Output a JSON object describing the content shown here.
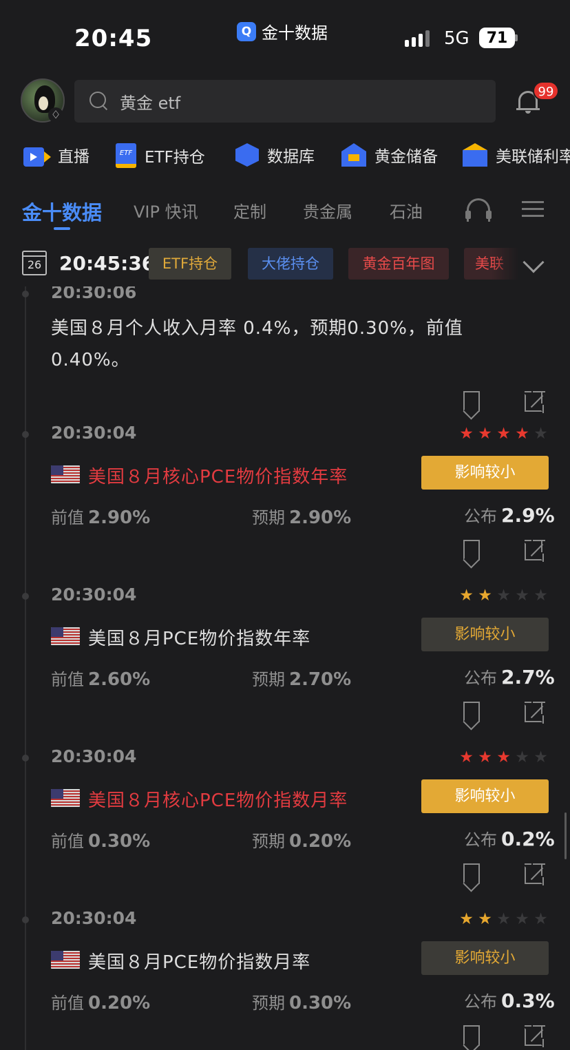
{
  "status_bar": {
    "time": "20:45",
    "app_name": "金十数据",
    "network": "5G",
    "battery": "71"
  },
  "search": {
    "value": "黄金 etf",
    "notification_count": "99"
  },
  "quick_nav": [
    {
      "label": "直播",
      "icon": "live-video-icon"
    },
    {
      "label": "ETF持仓",
      "icon": "etf-doc-icon"
    },
    {
      "label": "数据库",
      "icon": "database-cube-icon"
    },
    {
      "label": "黄金储备",
      "icon": "gold-reserve-icon"
    },
    {
      "label": "美联储利率",
      "icon": "bank-icon"
    }
  ],
  "tabs": [
    {
      "label": "金十数据",
      "active": true
    },
    {
      "label": "VIP 快讯"
    },
    {
      "label": "定制"
    },
    {
      "label": "贵金属"
    },
    {
      "label": "石油"
    }
  ],
  "date_row": {
    "calendar_day": "26",
    "clock": "20:45:36",
    "chips": [
      "ETF持仓",
      "大佬持仓",
      "黄金百年图",
      "美联储"
    ]
  },
  "feed": {
    "news": {
      "time": "20:30:06",
      "text": "美国８月个人收入月率 0.4%，预期0.30%，前值 0.40%。"
    },
    "labels": {
      "prev": "前值",
      "forecast": "预期",
      "actual": "公布"
    },
    "items": [
      {
        "time": "20:30:04",
        "stars": 4,
        "star_color": "#e8392f",
        "title": "美国８月核心PCE物价指数年率",
        "hot": true,
        "impact": "影响较小",
        "prev": "2.90%",
        "forecast": "2.90%",
        "actual": "2.9%"
      },
      {
        "time": "20:30:04",
        "stars": 2,
        "star_color": "#e7a72e",
        "title": "美国８月PCE物价指数年率",
        "hot": false,
        "impact": "影响较小",
        "prev": "2.60%",
        "forecast": "2.70%",
        "actual": "2.7%"
      },
      {
        "time": "20:30:04",
        "stars": 3,
        "star_color": "#e8392f",
        "title": "美国８月核心PCE物价指数月率",
        "hot": true,
        "impact": "影响较小",
        "prev": "0.30%",
        "forecast": "0.20%",
        "actual": "0.2%"
      },
      {
        "time": "20:30:04",
        "stars": 2,
        "star_color": "#e7a72e",
        "title": "美国８月PCE物价指数月率",
        "hot": false,
        "impact": "影响较小",
        "prev": "0.20%",
        "forecast": "0.30%",
        "actual": "0.3%"
      }
    ]
  }
}
